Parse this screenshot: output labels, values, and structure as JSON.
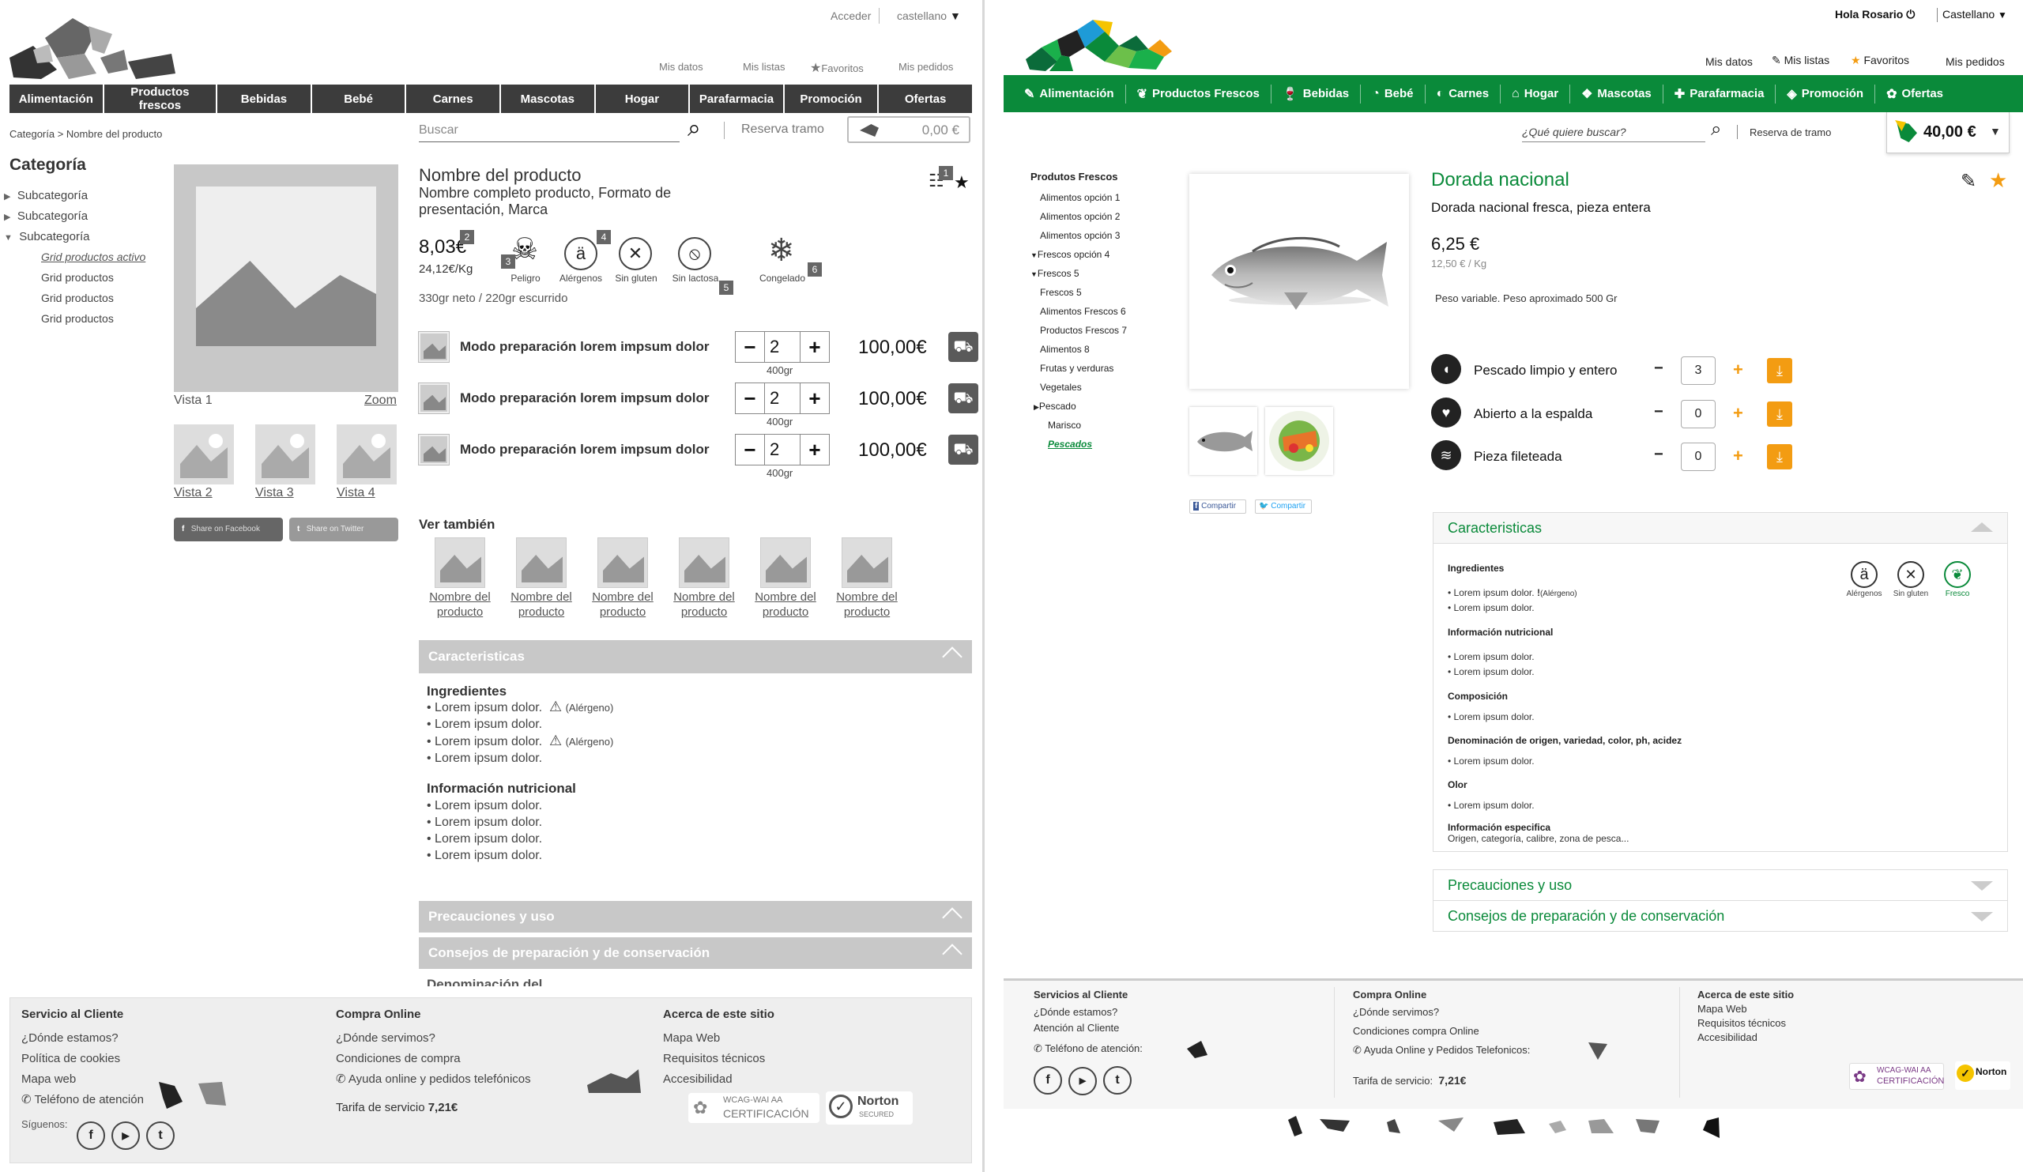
{
  "left": {
    "top_links": {
      "acceder": "Acceder",
      "language": "castellano"
    },
    "user_links": [
      "Mis datos",
      "Mis listas",
      "Favoritos",
      "Mis pedidos"
    ],
    "nav": [
      "Alimentación",
      "Productos frescos",
      "Bebidas",
      "Bebé",
      "Carnes",
      "Mascotas",
      "Hogar",
      "Parafarmacia",
      "Promoción",
      "Ofertas"
    ],
    "breadcrumb": "Categoría > Nombre del producto",
    "search_placeholder": "Buscar",
    "reserva": "Reserva tramo",
    "cart_total": "0,00 €",
    "sidebar": {
      "title": "Categoría",
      "subcats": [
        "Subcategoría",
        "Subcategoría",
        "Subcategoría"
      ],
      "children": [
        "Grid productos activo",
        "Grid productos",
        "Grid productos",
        "Grid productos"
      ]
    },
    "gallery": {
      "vista1": "Vista 1",
      "zoom": "Zoom",
      "thumbs": [
        "Vista 2",
        "Vista 3",
        "Vista 4"
      ],
      "share_fb": "Share on Facebook",
      "share_tw": "Share on Twitter"
    },
    "product": {
      "name": "Nombre del producto",
      "desc": "Nombre completo producto, Formato de presentación,  Marca",
      "price": "8,03€",
      "unit_price": "24,12€/Kg",
      "weight": "330gr neto / 220gr escurrido",
      "badges": [
        "1",
        "2",
        "3",
        "4",
        "5",
        "6"
      ],
      "icons": [
        {
          "name": "Peligro",
          "glyph": "☠"
        },
        {
          "name": "Alérgenos",
          "glyph": "ä"
        },
        {
          "name": "Sin gluten",
          "glyph": "✕"
        },
        {
          "name": "Sin lactosa",
          "glyph": "⦸"
        },
        {
          "name": "Congelado",
          "glyph": "❄"
        }
      ],
      "options": [
        {
          "label": "Modo preparación lorem impsum dolor",
          "qty": "2",
          "weight": "400gr",
          "price": "100,00€"
        },
        {
          "label": "Modo preparación lorem impsum dolor",
          "qty": "2",
          "weight": "400gr",
          "price": "100,00€"
        },
        {
          "label": "Modo preparación lorem impsum dolor",
          "qty": "2",
          "weight": "400gr",
          "price": "100,00€"
        }
      ]
    },
    "ver_tambien": {
      "title": "Ver también",
      "items": [
        "Nombre del producto",
        "Nombre del producto",
        "Nombre del producto",
        "Nombre del producto",
        "Nombre del producto",
        "Nombre del producto"
      ]
    },
    "caracteristicas": {
      "title": "Caracteristicas",
      "ingredientes_title": "Ingredientes",
      "ingredientes": [
        "• Lorem ipsum dolor.",
        "• Lorem ipsum dolor.",
        "• Lorem ipsum dolor.",
        "• Lorem ipsum dolor."
      ],
      "alergeno": "(Alérgeno)",
      "nutri_title": "Información nutricional",
      "nutri": [
        "• Lorem ipsum dolor.",
        "• Lorem ipsum dolor.",
        "• Lorem ipsum dolor.",
        "• Lorem ipsum dolor."
      ]
    },
    "precauciones": "Precauciones y uso",
    "consejos": "Consejos de preparación y de conservación",
    "cut_text": "Denominación del",
    "footer": {
      "col1": {
        "title": "Servicio al Cliente",
        "links": [
          "¿Dónde estamos?",
          "Política de cookies",
          "Mapa web"
        ],
        "phone": "Teléfono de atención",
        "siguenos": "Síguenos:"
      },
      "col2": {
        "title": "Compra Online",
        "links": [
          "¿Dónde servimos?",
          "Condiciones de compra"
        ],
        "help": "Ayuda online y pedidos telefónicos",
        "tarifa": "Tarifa de servicio",
        "tarifa_val": "7,21€"
      },
      "col3": {
        "title": "Acerca de este sitio",
        "links": [
          "Mapa Web",
          "Requisitos técnicos",
          "Accesibilidad"
        ]
      },
      "wcag_small": "WCAG-WAI AA",
      "wcag": "CERTIFICACIÓN",
      "norton": "Norton",
      "norton_sub": "SECURED"
    }
  },
  "right": {
    "greeting": "Hola Rosario",
    "language": "Castellano",
    "user_links": [
      "Mis datos",
      "Mis listas",
      "Favoritos",
      "Mis pedidos"
    ],
    "nav": [
      {
        "icon": "✎",
        "label": "Alimentación"
      },
      {
        "icon": "❦",
        "label": "Productos Frescos"
      },
      {
        "icon": "🍷",
        "label": "Bebidas"
      },
      {
        "icon": "◔",
        "label": "Bebé"
      },
      {
        "icon": "◐",
        "label": "Carnes"
      },
      {
        "icon": "⌂",
        "label": "Hogar"
      },
      {
        "icon": "❖",
        "label": "Mascotas"
      },
      {
        "icon": "✚",
        "label": "Parafarmacia"
      },
      {
        "icon": "◈",
        "label": "Promoción"
      },
      {
        "icon": "✿",
        "label": "Ofertas"
      }
    ],
    "search_placeholder": "¿Qué quiere buscar?",
    "reserva": "Reserva de tramo",
    "cart_total": "40,00 €",
    "sidebar": {
      "title": "Produtos Frescos",
      "items": [
        "Alimentos opción 1",
        "Alimentos opción 2",
        "Alimentos opción 3",
        "Frescos opción 4",
        "Frescos 5",
        "Frescos 5",
        "Alimentos Frescos 6",
        "Productos Frescos 7",
        "Alimentos 8",
        "Frutas y verduras",
        "Vegetales",
        "Pescado",
        "Marisco",
        "Pescados"
      ]
    },
    "product": {
      "name": "Dorada nacional",
      "desc": "Dorada nacional fresca, pieza entera",
      "price": "6,25 €",
      "unit_price": "12,50 € / Kg",
      "peso": "Peso variable.  Peso aproximado 500 Gr"
    },
    "share": [
      "Compartir",
      "Compartir"
    ],
    "options": [
      {
        "label": "Pescado limpio y entero",
        "qty": "3"
      },
      {
        "label": "Abierto a la espalda",
        "qty": "0"
      },
      {
        "label": "Pieza fileteada",
        "qty": "0"
      }
    ],
    "caracteristicas": {
      "title": "Caracteristicas",
      "icons": [
        "Alérgenos",
        "Sin gluten",
        "Fresco"
      ],
      "sections": [
        {
          "title": "Ingredientes",
          "items": [
            "• Lorem ipsum dolor.",
            "• Lorem ipsum dolor."
          ],
          "alergeno": "(Alérgeno)"
        },
        {
          "title": "Información nutricional",
          "items": [
            "• Lorem ipsum dolor.",
            "• Lorem ipsum dolor."
          ]
        },
        {
          "title": "Composición",
          "items": [
            "• Lorem ipsum dolor."
          ]
        },
        {
          "title": "Denominación de origen, variedad, color, ph, acidez",
          "items": [
            "• Lorem ipsum dolor."
          ]
        },
        {
          "title": "Olor",
          "items": [
            "• Lorem ipsum dolor."
          ]
        },
        {
          "title": "Información especifica",
          "items": [
            "Origen, categoría, calibre, zona de pesca..."
          ]
        }
      ]
    },
    "precauciones": "Precauciones y uso",
    "consejos": "Consejos de preparación y de conservación",
    "footer": {
      "col1": {
        "title": "Servicios al Cliente",
        "links": [
          "¿Dónde estamos?",
          "Atención al Cliente"
        ],
        "phone": "Teléfono de atención:"
      },
      "col2": {
        "title": "Compra Online",
        "links": [
          "¿Dónde servimos?",
          "Condiciones compra Online"
        ],
        "help": "Ayuda Online y Pedidos Telefonicos:",
        "tarifa": "Tarifa de servicio:",
        "tarifa_val": "7,21€"
      },
      "col3": {
        "title": "Acerca de este sitio",
        "links": [
          "Mapa Web",
          "Requisitos técnicos",
          "Accesibilidad"
        ]
      },
      "wcag_small": "WCAG-WAI AA",
      "wcag": "CERTIFICACIÓN",
      "norton": "Norton"
    }
  }
}
